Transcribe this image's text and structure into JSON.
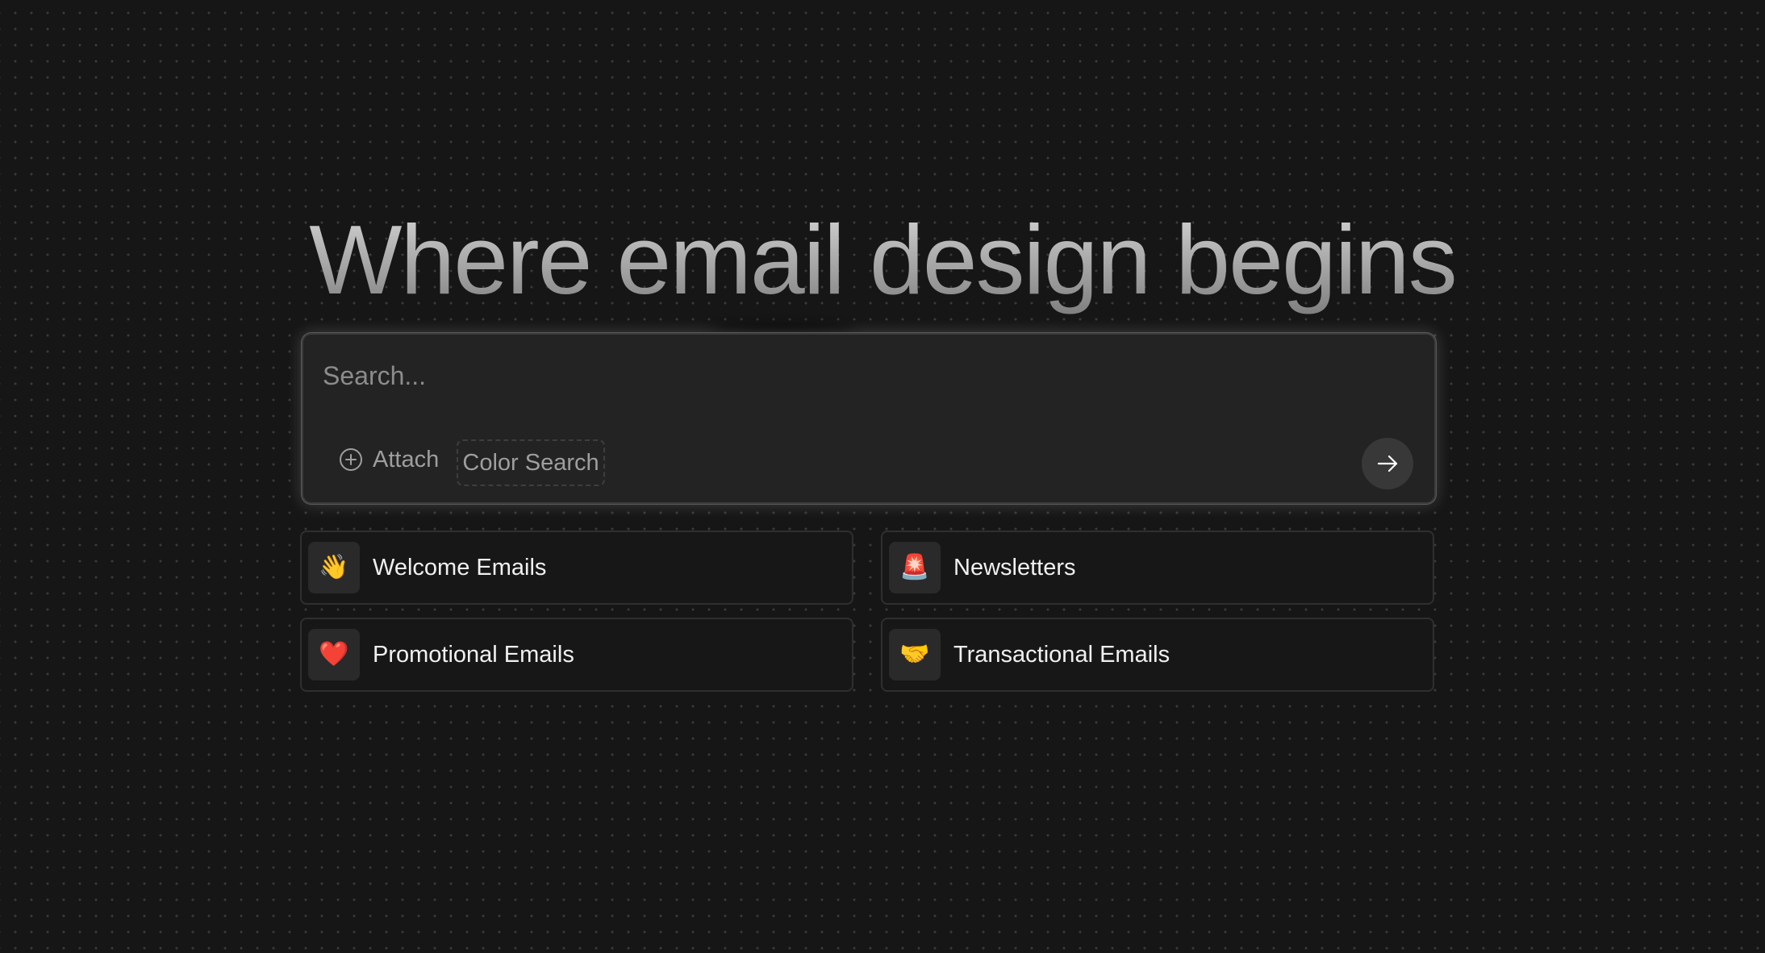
{
  "hero": {
    "title": "Where email design begins"
  },
  "search": {
    "placeholder": "Search...",
    "value": "",
    "attach_label": "Attach",
    "attach_icon": "plus-circle-icon",
    "color_search_label": "Color Search",
    "submit_icon": "arrow-right-icon"
  },
  "categories": [
    {
      "label": "Welcome Emails",
      "icon": "waving-hand-icon",
      "emoji": "👋"
    },
    {
      "label": "Newsletters",
      "icon": "siren-icon",
      "emoji": "🚨"
    },
    {
      "label": "Promotional Emails",
      "icon": "heart-icon",
      "emoji": "❤️"
    },
    {
      "label": "Transactional Emails",
      "icon": "handshake-icon",
      "emoji": "🤝"
    }
  ],
  "colors": {
    "background": "#161616",
    "dot_grid": "#3a3a3a",
    "search_box": "#232323",
    "card_background": "#171717",
    "card_border": "#2f2f2f",
    "muted_text": "#9e9e9e",
    "primary_text": "#f0f0f0"
  }
}
